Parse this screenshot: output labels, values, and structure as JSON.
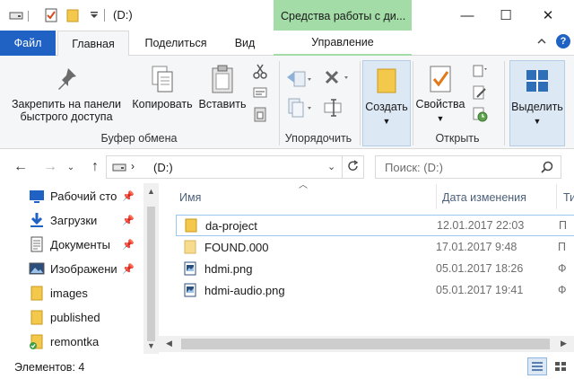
{
  "window": {
    "title": "(D:)",
    "context_tab": "Средства работы с ди...",
    "controls": {
      "minimize": "—",
      "maximize": "☐",
      "close": "✕"
    }
  },
  "tabs": {
    "file": "Файл",
    "home": "Главная",
    "share": "Поделиться",
    "view": "Вид",
    "manage": "Управление",
    "help": "?"
  },
  "ribbon": {
    "pin_label_1": "Закрепить на панели",
    "pin_label_2": "быстрого доступа",
    "copy": "Копировать",
    "paste": "Вставить",
    "group_clipboard": "Буфер обмена",
    "group_organize": "Упорядочить",
    "create": "Создать",
    "properties": "Свойства",
    "group_open": "Открыть",
    "select": "Выделить"
  },
  "address": {
    "path": "(D:)",
    "search_placeholder": "Поиск: (D:)"
  },
  "nav": {
    "items": [
      {
        "label": "Рабочий сто",
        "pinned": true,
        "icon": "desktop-icon"
      },
      {
        "label": "Загрузки",
        "pinned": true,
        "icon": "download-icon"
      },
      {
        "label": "Документы",
        "pinned": true,
        "icon": "documents-icon"
      },
      {
        "label": "Изображени",
        "pinned": true,
        "icon": "pictures-icon"
      },
      {
        "label": "images",
        "pinned": false,
        "icon": "folder-icon"
      },
      {
        "label": "published",
        "pinned": false,
        "icon": "folder-icon"
      },
      {
        "label": "remontka",
        "pinned": false,
        "icon": "folder-icon"
      }
    ]
  },
  "files": {
    "columns": {
      "name": "Имя",
      "date": "Дата изменения",
      "type": "Ти"
    },
    "rows": [
      {
        "name": "da-project",
        "date": "12.01.2017 22:03",
        "type": "П",
        "icon": "folder-icon"
      },
      {
        "name": "FOUND.000",
        "date": "17.01.2017 9:48",
        "type": "П",
        "icon": "folder-icon"
      },
      {
        "name": "hdmi.png",
        "date": "05.01.2017 18:26",
        "type": "Ф",
        "icon": "image-file-icon"
      },
      {
        "name": "hdmi-audio.png",
        "date": "05.01.2017 19:41",
        "type": "Ф",
        "icon": "image-file-icon"
      }
    ]
  },
  "status": {
    "items_count": "Элементов: 4"
  },
  "colors": {
    "accent": "#1f62c4",
    "context_tab": "#a3dca7",
    "folder": "#f3c84b",
    "selection_border": "#9bc6f0"
  }
}
